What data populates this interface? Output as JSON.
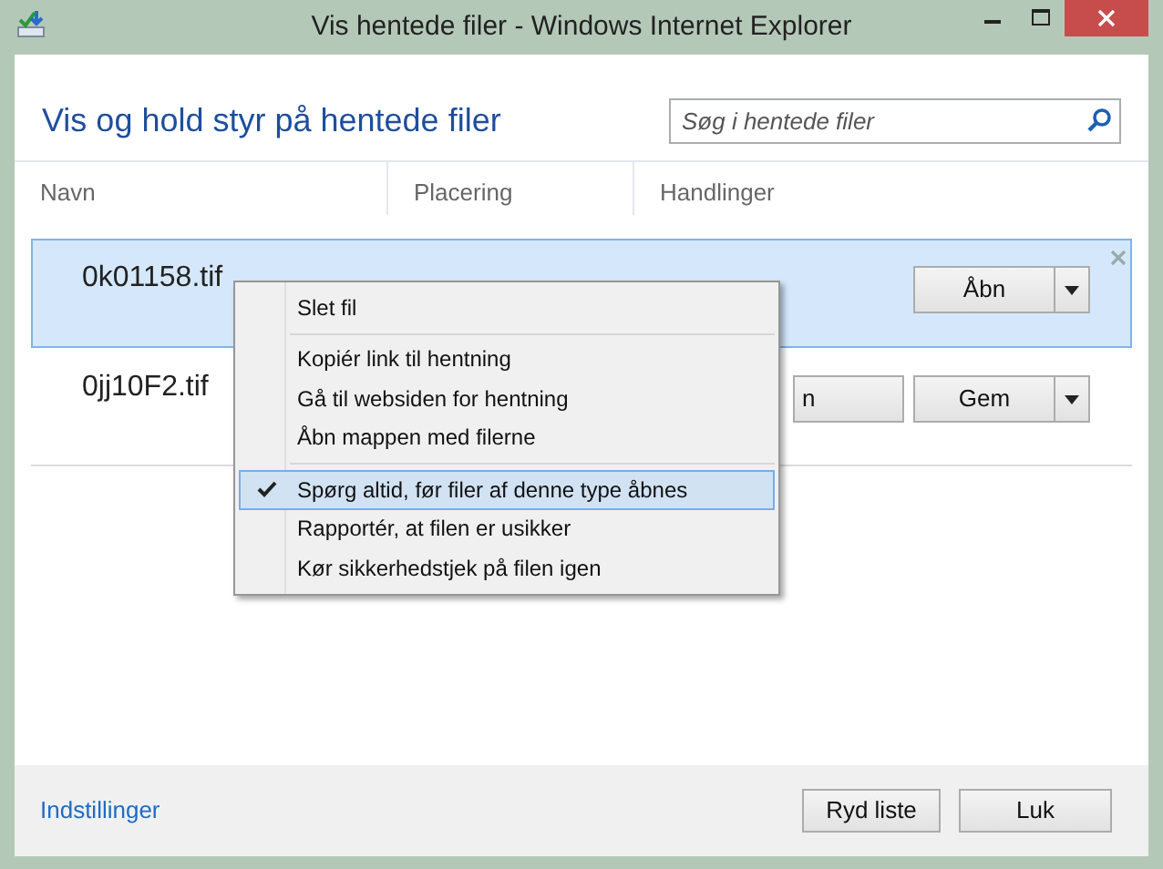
{
  "window": {
    "title": "Vis hentede filer - Windows Internet Explorer"
  },
  "heading": "Vis og hold styr på hentede filer",
  "search": {
    "placeholder": "Søg i hentede filer"
  },
  "columns": [
    "Navn",
    "Placering",
    "Handlinger"
  ],
  "rows": [
    {
      "name": "0k01158.tif",
      "selected": true,
      "actions": [
        {
          "label": "Åbn"
        }
      ]
    },
    {
      "name": "0jj10F2.tif",
      "selected": false,
      "actions": [
        {
          "label": "n"
        },
        {
          "label": "Gem"
        }
      ]
    }
  ],
  "context_menu": {
    "items": [
      {
        "kind": "item",
        "label": "Slet fil",
        "checked": false,
        "selected": false
      },
      {
        "kind": "separator"
      },
      {
        "kind": "item",
        "label": "Kopiér link til hentning",
        "checked": false,
        "selected": false
      },
      {
        "kind": "item",
        "label": "Gå til websiden for hentning",
        "checked": false,
        "selected": false
      },
      {
        "kind": "item",
        "label": "Åbn mappen med filerne",
        "checked": false,
        "selected": false
      },
      {
        "kind": "separator"
      },
      {
        "kind": "item",
        "label": "Spørg altid, før filer af denne type åbnes",
        "checked": true,
        "selected": true
      },
      {
        "kind": "item",
        "label": "Rapportér, at filen er usikker",
        "checked": false,
        "selected": false
      },
      {
        "kind": "item",
        "label": "Kør sikkerhedstjek på filen igen",
        "checked": false,
        "selected": false
      }
    ]
  },
  "footer": {
    "link": "Indstillinger",
    "buttons": [
      "Ryd liste",
      "Luk"
    ]
  }
}
